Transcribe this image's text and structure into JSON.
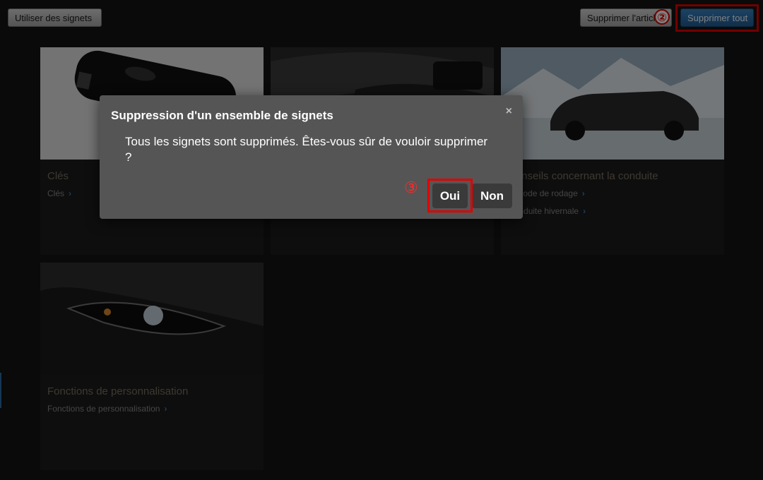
{
  "toolbar": {
    "use_bookmarks_label": "Utiliser des signets",
    "delete_article_label": "Supprimer l'article",
    "delete_all_label": "Supprimer tout"
  },
  "annotations": {
    "step2": "②",
    "step3": "③"
  },
  "cards": [
    {
      "title": "Clés",
      "links": [
        "Clés"
      ]
    },
    {
      "title": "",
      "links": []
    },
    {
      "title": "Conseils concernant la conduite",
      "links": [
        "Période de rodage",
        "Conduite hivernale"
      ]
    },
    {
      "title": "Fonctions de personnalisation",
      "links": [
        "Fonctions de personnalisation"
      ]
    }
  ],
  "modal": {
    "title": "Suppression d'un ensemble de signets",
    "close_glyph": "×",
    "message": "Tous les signets sont supprimés. Êtes-vous sûr de vouloir supprimer ?",
    "yes_label": "Oui",
    "no_label": "Non"
  },
  "colors": {
    "accent_blue": "#2f7fc2",
    "annotation_red": "#e00000",
    "modal_bg": "#555555"
  }
}
